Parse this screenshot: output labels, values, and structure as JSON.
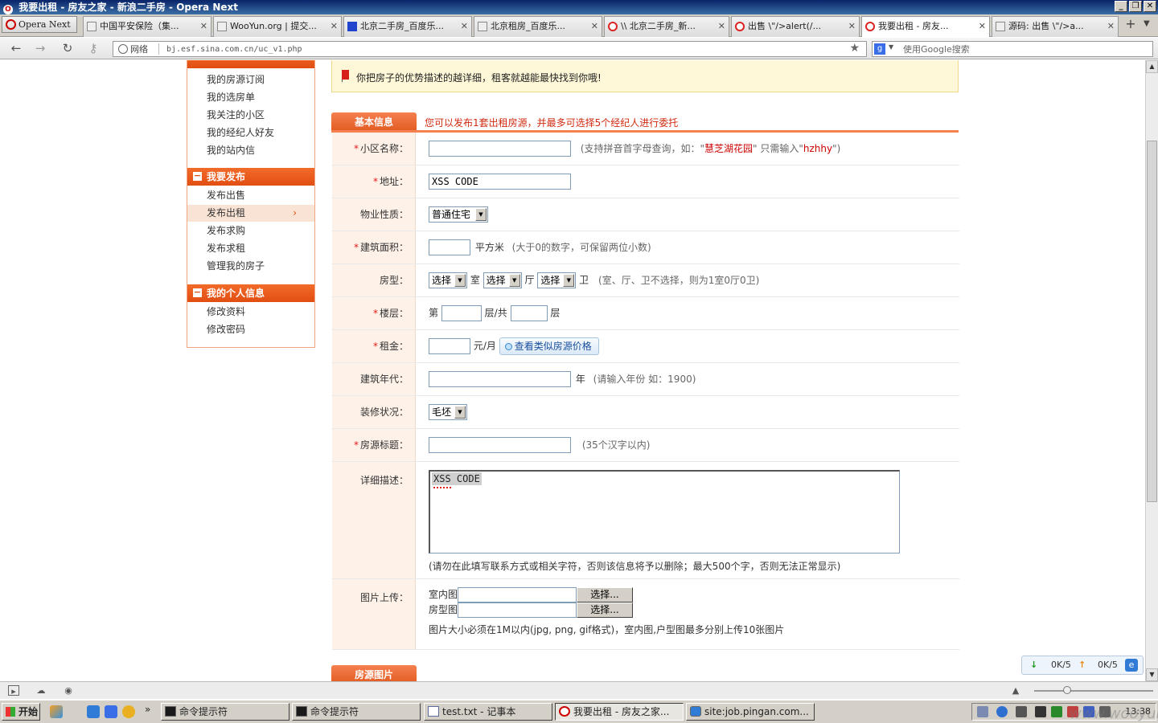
{
  "window": {
    "title": "我要出租 - 房友之家 - 新浪二手房 - Opera Next"
  },
  "browser": {
    "menu_label": "Opera Next",
    "tabs": [
      {
        "label": "中国平安保险（集...",
        "active": false
      },
      {
        "label": "WooYun.org | 提交...",
        "active": false
      },
      {
        "label": "北京二手房_百度乐...",
        "active": false
      },
      {
        "label": "北京租房_百度乐...",
        "active": false
      },
      {
        "label": "\\\\ 北京二手房_新...",
        "active": false
      },
      {
        "label": "出售 \\\"/>alert(/...",
        "active": false
      },
      {
        "label": "我要出租 - 房友...",
        "active": true
      },
      {
        "label": "源码: 出售 \\\"/>a...",
        "active": false
      }
    ],
    "security_label": "网络",
    "url": "bj.esf.sina.com.cn/uc_v1.php",
    "search_placeholder": "使用Google搜索"
  },
  "tip": {
    "text": "你把房子的优势描述的越详细，租客就越能最快找到你哦!"
  },
  "sidebar": {
    "top_items": [
      "我的房源订阅",
      "我的选房单",
      "我关注的小区",
      "我的经纪人好友",
      "我的站内信"
    ],
    "sections": [
      {
        "title": "我要发布",
        "items": [
          "发布出售",
          "发布出租",
          "发布求购",
          "发布求租",
          "管理我的房子"
        ],
        "active_index": 1
      },
      {
        "title": "我的个人信息",
        "items": [
          "修改资料",
          "修改密码"
        ]
      }
    ]
  },
  "section": {
    "basic_tab": "基本信息",
    "basic_note": "您可以发布1套出租房源，并最多可选择5个经纪人进行委托",
    "photos_tab": "房源图片"
  },
  "form": {
    "community": {
      "label": "小区名称：",
      "value": "",
      "hint_a": "(支持拼音首字母查询，如：\"",
      "hint_red1": "慧芝湖花园",
      "hint_b": "\" 只需输入\"",
      "hint_red2": "hzhhy",
      "hint_c": "\")"
    },
    "address": {
      "label": "地址：",
      "value": "XSS CODE"
    },
    "property_type": {
      "label": "物业性质：",
      "value": "普通住宅"
    },
    "area": {
      "label": "建筑面积：",
      "unit": "平方米",
      "hint": "(大于0的数字，可保留两位小数)"
    },
    "layout": {
      "label": "房型：",
      "select_placeholder": "选择",
      "room": "室",
      "hall": "厅",
      "bath": "卫",
      "hint": "(室、厅、卫不选择，则为1室0厅0卫)"
    },
    "floor": {
      "label": "楼层：",
      "prefix": "第",
      "mid": "层/共",
      "suffix": "层"
    },
    "rent": {
      "label": "租金：",
      "unit": "元/月",
      "button": "查看类似房源价格"
    },
    "year": {
      "label": "建筑年代：",
      "unit": "年",
      "hint": "(请输入年份 如：1900)"
    },
    "decoration": {
      "label": "装修状况：",
      "value": "毛坯"
    },
    "listing_title": {
      "label": "房源标题：",
      "hint": "(35个汉字以内)"
    },
    "description": {
      "label": "详细描述：",
      "value": "XSS CODE",
      "hint": "(请勿在此填写联系方式或相关字符，否则该信息将予以删除；最大500个字，否则无法正常显示)"
    },
    "upload": {
      "label": "图片上传：",
      "indoor": "室内图",
      "plan": "房型图",
      "button": "选择...",
      "hint": "图片大小必须在1M以内(jpg, png, gif格式)，室内图,户型图最多分别上传10张图片"
    }
  },
  "transfer": {
    "down": "0K/5",
    "up": "0K/5"
  },
  "taskbar": {
    "start": "开始",
    "tasks": [
      {
        "label": "命令提示符",
        "icon": "cmd",
        "active": false
      },
      {
        "label": "命令提示符",
        "icon": "cmd",
        "active": false
      },
      {
        "label": "test.txt - 记事本",
        "icon": "notepad",
        "active": false
      },
      {
        "label": "我要出租 - 房友之家...",
        "icon": "opera",
        "active": true
      },
      {
        "label": "site:job.pingan.com...",
        "icon": "ie",
        "active": false
      }
    ],
    "clock": "13:38"
  },
  "watermark": "www.wooyun.org",
  "colors": {
    "accent": "#e8561a",
    "tip_bg": "#fff8d8",
    "label_bg": "#fdf1e8",
    "required": "#e0201a"
  }
}
